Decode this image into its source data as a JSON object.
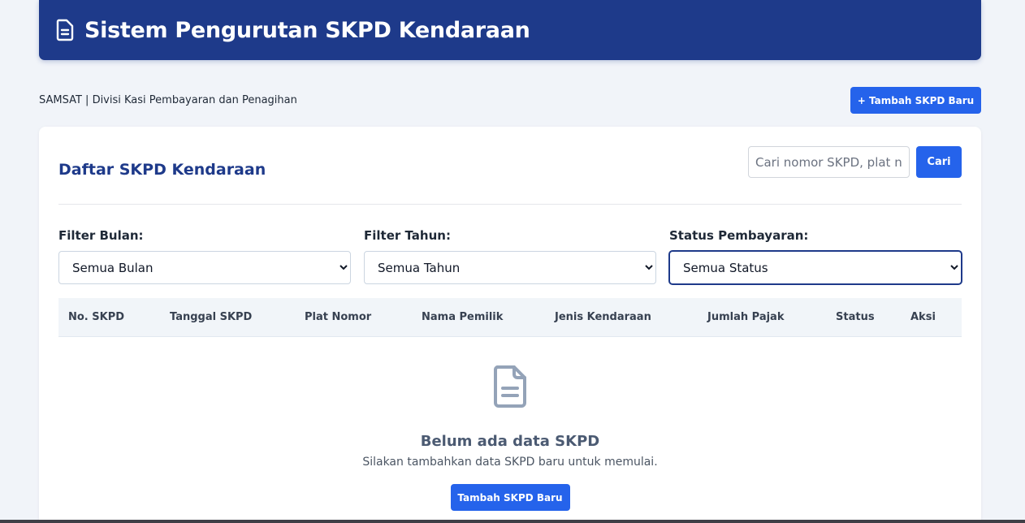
{
  "header": {
    "title": "Sistem Pengurutan SKPD Kendaraan",
    "icon": "document-icon",
    "bg_color": "#1e3a8a"
  },
  "subheader": {
    "org_text": "SAMSAT | Divisi Kasi Pembayaran dan Penagihan",
    "add_button_label": "+ Tambah SKPD Baru"
  },
  "card": {
    "title": "Daftar SKPD Kendaraan",
    "search": {
      "placeholder": "Cari nomor SKPD, plat nomor",
      "value": "",
      "button_label": "Cari"
    },
    "filters": [
      {
        "label": "Filter Bulan:",
        "selected": "Semua Bulan"
      },
      {
        "label": "Filter Tahun:",
        "selected": "Semua Tahun"
      },
      {
        "label": "Status Pembayaran:",
        "selected": "Semua Status"
      }
    ],
    "table": {
      "columns": [
        "No. SKPD",
        "Tanggal SKPD",
        "Plat Nomor",
        "Nama Pemilik",
        "Jenis Kendaraan",
        "Jumlah Pajak",
        "Status",
        "Aksi"
      ]
    },
    "empty_state": {
      "icon": "document-icon",
      "title": "Belum ada data SKPD",
      "subtitle": "Silakan tambahkan data SKPD baru untuk memulai.",
      "button_label": "Tambah SKPD Baru"
    }
  },
  "colors": {
    "primary": "#2563eb",
    "navy": "#1e3a8a",
    "background": "#f1f4f9"
  }
}
